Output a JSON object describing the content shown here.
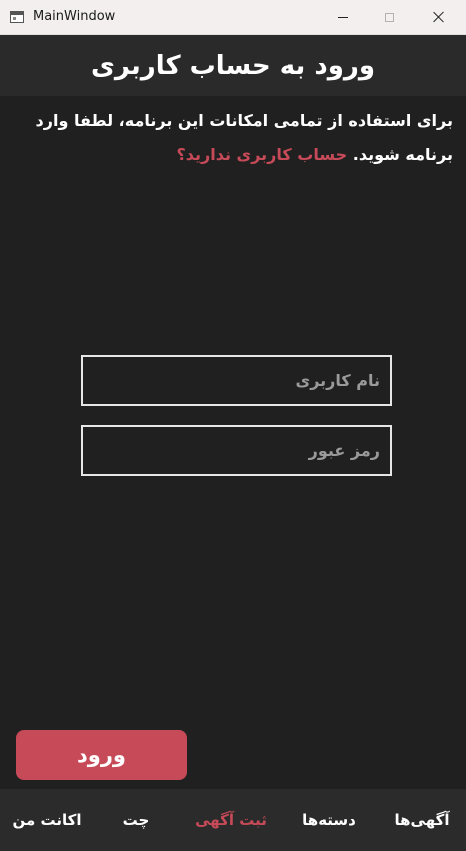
{
  "window": {
    "title": "MainWindow"
  },
  "header": {
    "title": "ورود به حساب کاربری"
  },
  "intro": {
    "text": "برای استفاده از تمامی امکانات این برنامه، لطفا وارد برنامه شوید.",
    "link_text": "حساب کاربری ندارید؟"
  },
  "form": {
    "username": {
      "value": "",
      "placeholder": "نام کاربری"
    },
    "password": {
      "value": "",
      "placeholder": "رمز عبور"
    },
    "login_label": "ورود"
  },
  "bottom_nav": {
    "items": [
      {
        "label": "آگهی‌ها"
      },
      {
        "label": "دسته‌ها"
      },
      {
        "label": "ثبت آگهی"
      },
      {
        "label": "چت"
      },
      {
        "label": "اکانت من"
      }
    ],
    "active_index": 2
  },
  "colors": {
    "accent": "#c74a58",
    "background": "#202020",
    "header_bg": "#2a2a2a",
    "nav_bg": "#2b2b2b",
    "text": "#ffffff",
    "placeholder": "#9a9a9a"
  },
  "icons": {
    "app": "window-app-icon",
    "minimize": "minimize-icon",
    "maximize": "maximize-icon",
    "close": "close-icon"
  }
}
